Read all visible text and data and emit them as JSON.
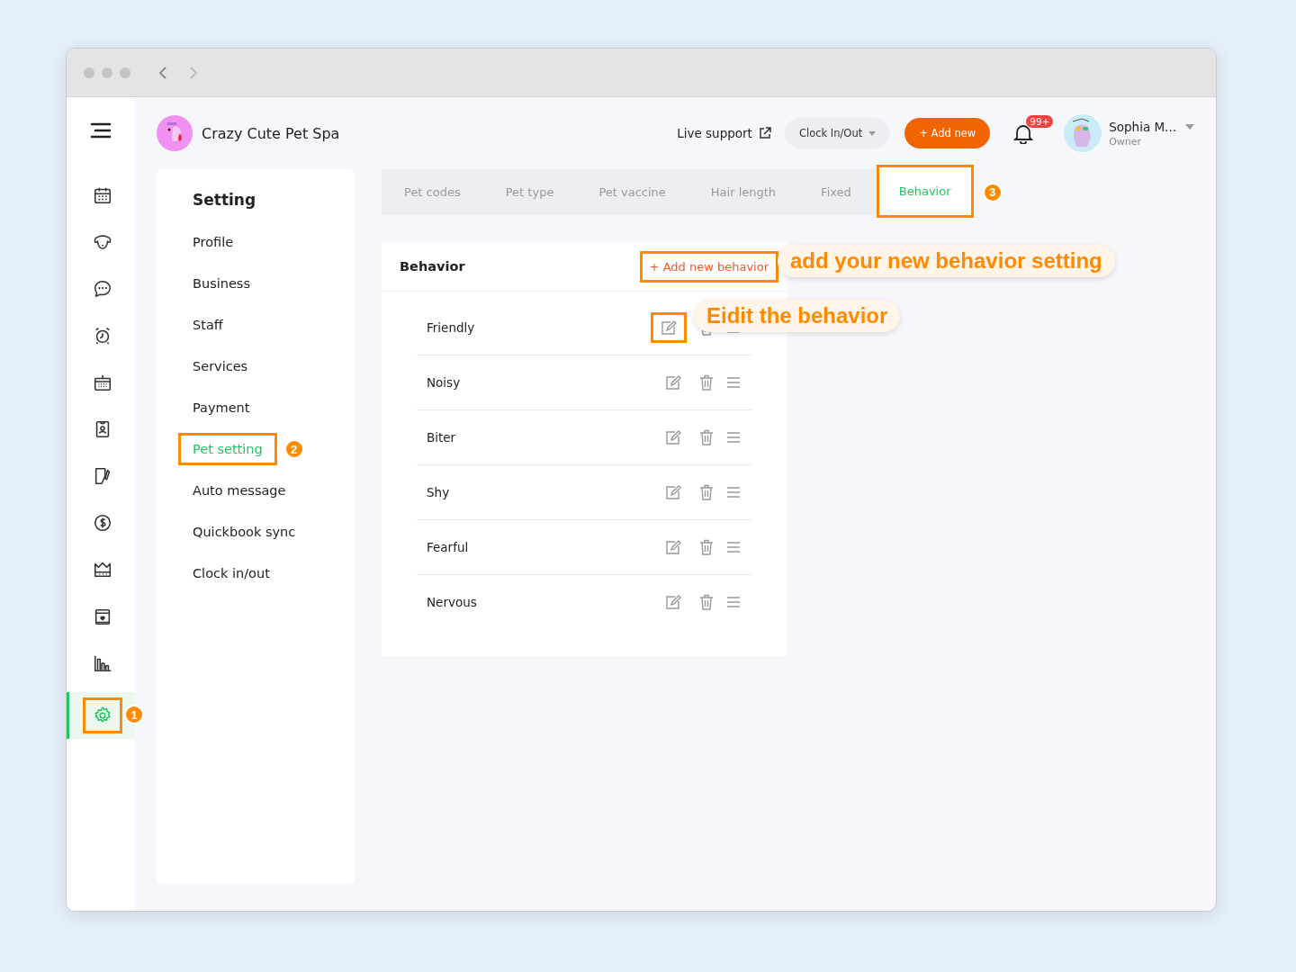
{
  "brand": {
    "name": "Crazy Cute Pet Spa"
  },
  "header": {
    "live_support": "Live support",
    "clock_button": "Clock In/Out",
    "add_button": "+ Add new",
    "notification_count": "99+",
    "user": {
      "name": "Sophia M...",
      "role": "Owner"
    }
  },
  "nav": [
    {
      "selected": false,
      "highlighted": false
    },
    {
      "selected": false,
      "highlighted": false
    },
    {
      "selected": false,
      "highlighted": false
    },
    {
      "selected": false,
      "highlighted": false
    },
    {
      "selected": false,
      "highlighted": false
    },
    {
      "selected": false,
      "highlighted": false
    },
    {
      "selected": false,
      "highlighted": false
    },
    {
      "selected": false,
      "highlighted": false
    },
    {
      "selected": false,
      "highlighted": false
    },
    {
      "selected": false,
      "highlighted": false
    },
    {
      "selected": false,
      "highlighted": false
    },
    {
      "selected": true,
      "highlighted": true,
      "step": "1"
    }
  ],
  "settings_menu": {
    "title": "Setting",
    "items": [
      {
        "label": "Profile",
        "selected": false,
        "highlighted": false
      },
      {
        "label": "Business",
        "selected": false,
        "highlighted": false
      },
      {
        "label": "Staff",
        "selected": false,
        "highlighted": false
      },
      {
        "label": "Services",
        "selected": false,
        "highlighted": false
      },
      {
        "label": "Payment",
        "selected": false,
        "highlighted": false
      },
      {
        "label": "Pet setting",
        "selected": true,
        "highlighted": true,
        "step": "2"
      },
      {
        "label": "Auto message",
        "selected": false,
        "highlighted": false
      },
      {
        "label": "Quickbook sync",
        "selected": false,
        "highlighted": false
      },
      {
        "label": "Clock in/out",
        "selected": false,
        "highlighted": false
      }
    ]
  },
  "tabs": [
    {
      "label": "Pet codes",
      "selected": false,
      "highlighted": false
    },
    {
      "label": "Pet type",
      "selected": false,
      "highlighted": false
    },
    {
      "label": "Pet vaccine",
      "selected": false,
      "highlighted": false
    },
    {
      "label": "Hair length",
      "selected": false,
      "highlighted": false
    },
    {
      "label": "Fixed",
      "selected": false,
      "highlighted": false
    },
    {
      "label": "Behavior",
      "selected": true,
      "highlighted": true,
      "step": "3"
    }
  ],
  "behavior_panel": {
    "title": "Behavior",
    "add_button": {
      "label": "+ Add new behavior",
      "highlighted": true
    },
    "callout": "add your new behavior setting",
    "rows": [
      {
        "name": "Friendly",
        "edit_highlighted": true,
        "callout": "Eidit the behavior"
      },
      {
        "name": "Noisy",
        "edit_highlighted": false
      },
      {
        "name": "Biter",
        "edit_highlighted": false
      },
      {
        "name": "Shy",
        "edit_highlighted": false
      },
      {
        "name": "Fearful",
        "edit_highlighted": false
      },
      {
        "name": "Nervous",
        "edit_highlighted": false
      }
    ]
  }
}
